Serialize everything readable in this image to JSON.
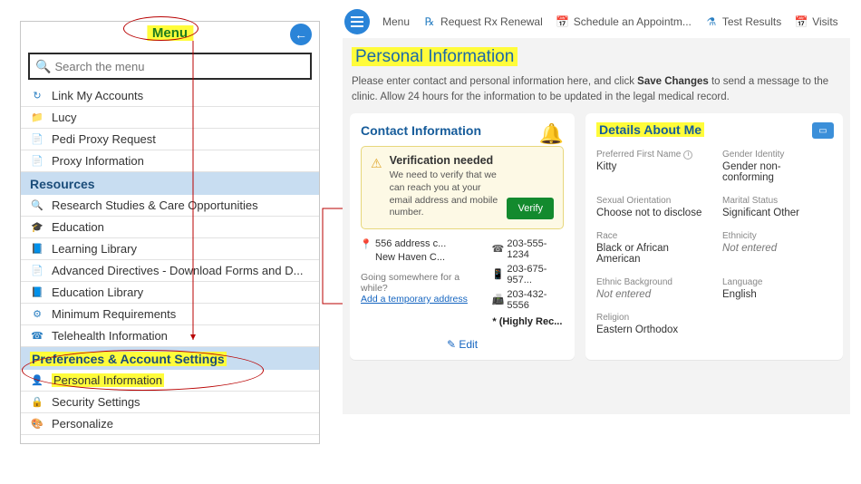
{
  "menu": {
    "title": "Menu",
    "search_placeholder": "Search the menu",
    "items_top": [
      {
        "icon": "↻",
        "label": "Link My Accounts"
      },
      {
        "icon": "📁",
        "label": "Lucy"
      },
      {
        "icon": "📄",
        "label": "Pedi Proxy Request"
      },
      {
        "icon": "📄",
        "label": "Proxy Information"
      }
    ],
    "section_resources": "Resources",
    "items_resources": [
      {
        "icon": "🔍",
        "label": "Research Studies & Care Opportunities"
      },
      {
        "icon": "🎓",
        "label": "Education"
      },
      {
        "icon": "📘",
        "label": "Learning Library"
      },
      {
        "icon": "📄",
        "label": "Advanced Directives - Download Forms and D..."
      },
      {
        "icon": "📘",
        "label": "Education Library"
      },
      {
        "icon": "⚙",
        "label": "Minimum Requirements"
      },
      {
        "icon": "☎",
        "label": "Telehealth Information"
      }
    ],
    "section_prefs": "Preferences & Account Settings",
    "items_prefs": [
      {
        "icon": "👤",
        "label": "Personal Information",
        "highlight": true
      },
      {
        "icon": "🔒",
        "label": "Security Settings"
      },
      {
        "icon": "🎨",
        "label": "Personalize"
      }
    ]
  },
  "topbar": {
    "menu": "Menu",
    "rx": "Request Rx Renewal",
    "appt": "Schedule an Appointm...",
    "results": "Test Results",
    "visits": "Visits"
  },
  "page": {
    "title": "Personal Information",
    "intro_pre": "Please enter contact and personal information here, and click ",
    "intro_bold": "Save Changes",
    "intro_post": " to send a message to the clinic. Allow 24 hours for the information to be updated in the legal medical record."
  },
  "contact": {
    "heading": "Contact Information",
    "verify_title": "Verification needed",
    "verify_text": "We need to verify that we can reach you at your email address and mobile number.",
    "verify_btn": "Verify",
    "addr1": "556 address c...",
    "addr2": "New Haven C...",
    "phone1": "203-555-1234",
    "phone2": "203-675-957...",
    "phone3": "203-432-5556",
    "going": "Going somewhere for a while?",
    "templink": "Add a temporary address",
    "highly": "* (Highly Rec...",
    "edit": "Edit"
  },
  "details": {
    "heading": "Details About Me",
    "fields": {
      "pref_name_label": "Preferred First Name",
      "pref_name": "Kitty",
      "gender_label": "Gender Identity",
      "gender": "Gender non-conforming",
      "orient_label": "Sexual Orientation",
      "orient": "Choose not to disclose",
      "marital_label": "Marital Status",
      "marital": "Significant Other",
      "race_label": "Race",
      "race": "Black or African American",
      "eth_label": "Ethnicity",
      "eth": "Not entered",
      "ethbg_label": "Ethnic Background",
      "ethbg": "Not entered",
      "lang_label": "Language",
      "lang": "English",
      "relig_label": "Religion",
      "relig": "Eastern Orthodox"
    }
  }
}
